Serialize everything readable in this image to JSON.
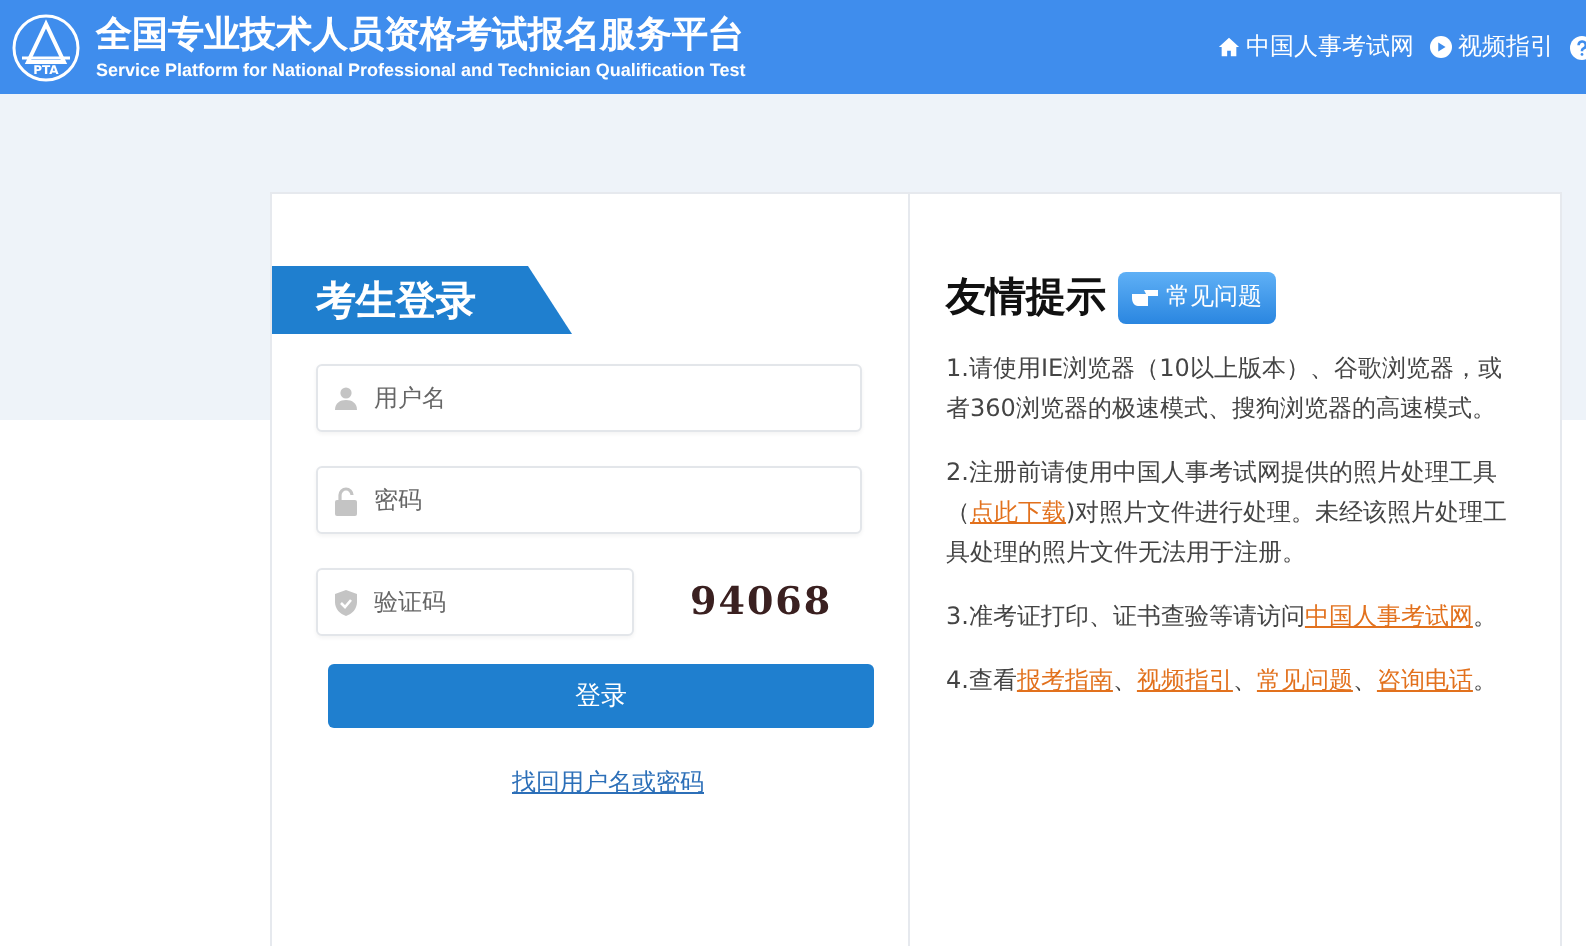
{
  "header": {
    "title": "全国专业技术人员资格考试报名服务平台",
    "subtitle": "Service Platform for National Professional and Technician Qualification Test",
    "logo_text": "PTA",
    "nav": [
      {
        "kind": "home",
        "label": "中国人事考试网"
      },
      {
        "kind": "play",
        "label": "视频指引"
      },
      {
        "kind": "help"
      }
    ]
  },
  "login": {
    "title": "考生登录",
    "fields": [
      {
        "kind": "user",
        "placeholder": "用户名"
      },
      {
        "kind": "lock",
        "placeholder": "密码"
      }
    ],
    "captcha": {
      "placeholder": "验证码",
      "code": "94068"
    },
    "submit": "登录",
    "recover": "找回用户名或密码"
  },
  "tips": {
    "title": "友情提示",
    "faq_button": "常见问题",
    "items": [
      [
        {
          "kind": "text",
          "text": "1.请使用IE浏览器（10以上版本）、谷歌浏览器，或者360浏览器的极速模式、搜狗浏览器的高速模式。"
        }
      ],
      [
        {
          "kind": "text",
          "text": "2.注册前请使用中国人事考试网提供的照片处理工具（"
        },
        {
          "kind": "link",
          "text": "点此下载"
        },
        {
          "kind": "text",
          "text": ")对照片文件进行处理。未经该照片处理工具处理的照片文件无法用于注册。"
        }
      ],
      [
        {
          "kind": "text",
          "text": "3.准考证打印、证书查验等请访问"
        },
        {
          "kind": "link",
          "text": "中国人事考试网"
        },
        {
          "kind": "text",
          "text": "。"
        }
      ],
      [
        {
          "kind": "text",
          "text": "4.查看"
        },
        {
          "kind": "link",
          "text": "报考指南"
        },
        {
          "kind": "text",
          "text": "、"
        },
        {
          "kind": "link",
          "text": "视频指引"
        },
        {
          "kind": "text",
          "text": "、"
        },
        {
          "kind": "link",
          "text": "常见问题"
        },
        {
          "kind": "text",
          "text": "、"
        },
        {
          "kind": "link",
          "text": "咨询电话"
        },
        {
          "kind": "text",
          "text": "。"
        }
      ]
    ]
  }
}
